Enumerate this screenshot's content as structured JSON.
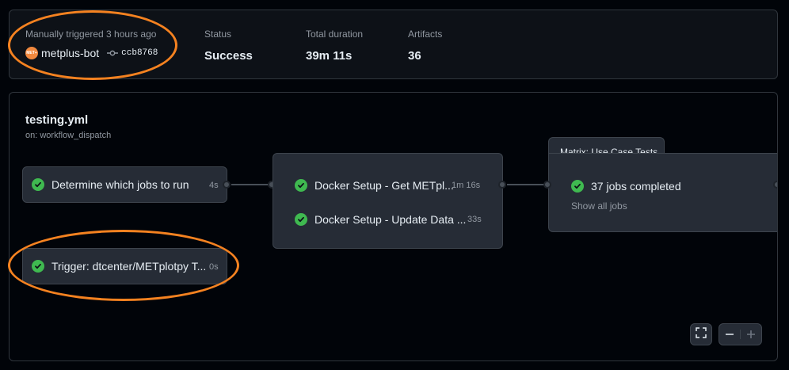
{
  "summary": {
    "trigger_label": "Manually triggered 3 hours ago",
    "actor": "metplus-bot",
    "avatar_text": "MET+",
    "commit_sha": "ccb8768",
    "status_label": "Status",
    "status_value": "Success",
    "duration_label": "Total duration",
    "duration_value": "39m 11s",
    "artifacts_label": "Artifacts",
    "artifacts_value": "36"
  },
  "workflow": {
    "file": "testing.yml",
    "trigger": "on: workflow_dispatch"
  },
  "jobs": {
    "determine": {
      "name": "Determine which jobs to run",
      "duration": "4s"
    },
    "trigger": {
      "name": "Trigger: dtcenter/METplotpy T...",
      "duration": "0s"
    },
    "docker_get": {
      "name": "Docker Setup - Get METpl...",
      "duration": "1m 16s"
    },
    "docker_update": {
      "name": "Docker Setup - Update Data ...",
      "duration": "33s"
    }
  },
  "matrix": {
    "title": "Matrix: Use Case Tests",
    "status": "37 jobs completed",
    "show_all": "Show all jobs"
  },
  "controls": [
    "fullscreen-icon",
    "zoom-out-icon",
    "zoom-in-icon"
  ],
  "colors": {
    "success": "#3fb950",
    "annotation": "#f58220",
    "card": "#262c36",
    "background": "#010409"
  }
}
